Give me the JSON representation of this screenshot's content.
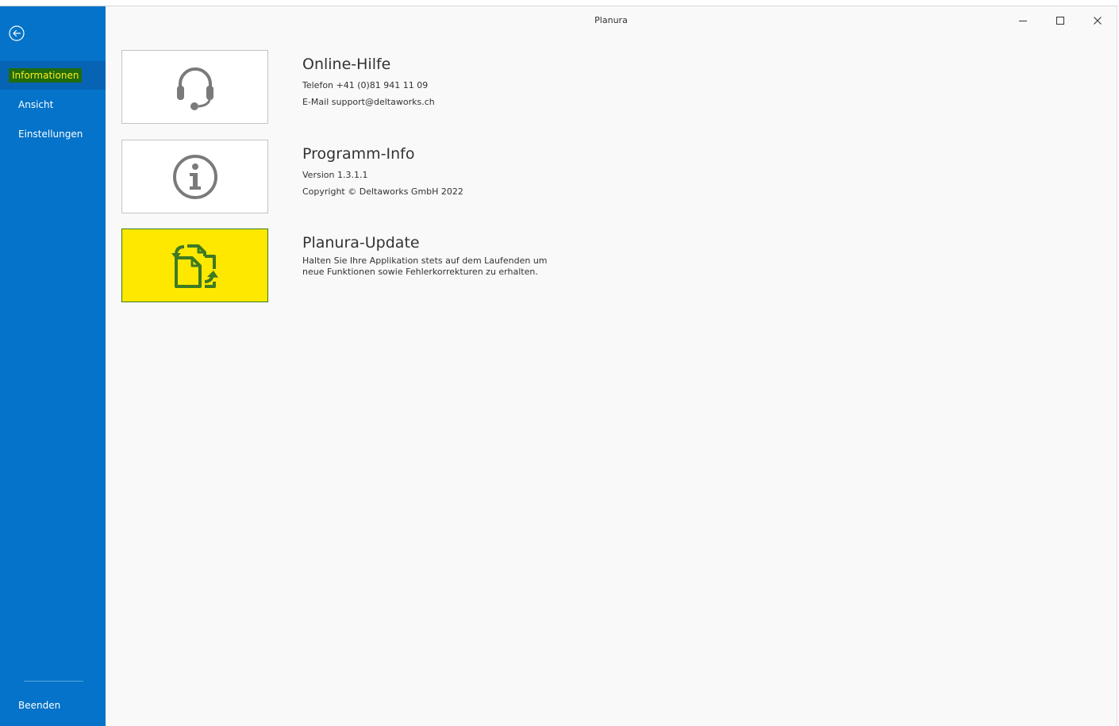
{
  "window": {
    "title": "Planura"
  },
  "sidebar": {
    "items": [
      {
        "label": "Informationen"
      },
      {
        "label": "Ansicht"
      },
      {
        "label": "Einstellungen"
      }
    ],
    "exit_label": "Beenden"
  },
  "sections": {
    "help": {
      "title": "Online-Hilfe",
      "phone_label": "Telefon",
      "phone_value": "+41 (0)81 941 11 09",
      "email_label": "E-Mail",
      "email_value": "support@deltaworks.ch"
    },
    "info": {
      "title": "Programm-Info",
      "version_label": "Version",
      "version_value": "1.3.1.1",
      "copyright": "Copyright © Deltaworks GmbH 2022"
    },
    "update": {
      "title": "Planura-Update",
      "description": "Halten Sie Ihre Applikation stets auf dem Laufenden um neue Funktionen sowie Fehlerkorrekturen zu erhalten."
    }
  },
  "colors": {
    "sidebar": "#0473c9",
    "sidebar_active": "#0764b4",
    "highlight_yellow": "#ffe800",
    "highlight_green": "#3d7a22",
    "icon_gray": "#7a7a7a"
  },
  "icons": {
    "back": "back-arrow-circle-icon",
    "help": "headset-icon",
    "info": "info-circle-icon",
    "update": "document-sync-icon"
  }
}
